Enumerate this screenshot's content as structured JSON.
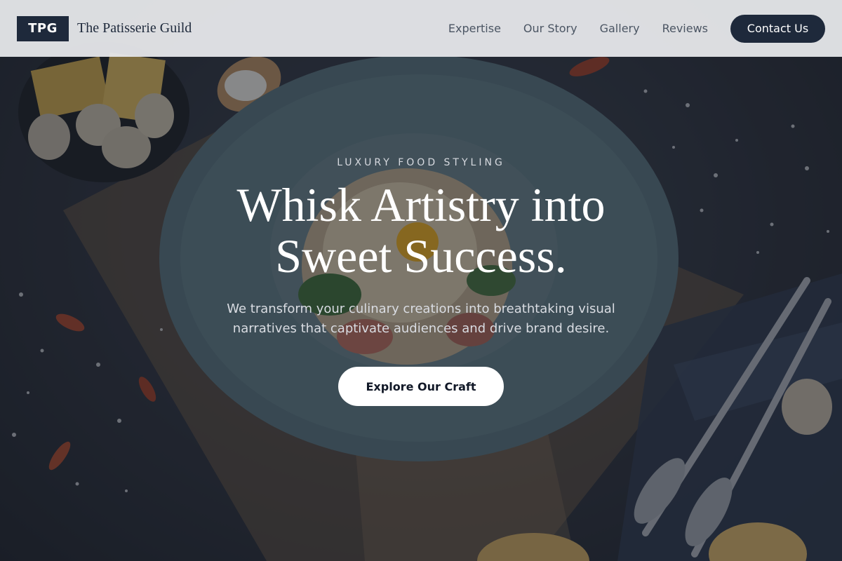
{
  "brand": {
    "logo_text": "TPG",
    "name": "The Patisserie Guild"
  },
  "nav": {
    "items": [
      {
        "label": "Expertise"
      },
      {
        "label": "Our Story"
      },
      {
        "label": "Gallery"
      },
      {
        "label": "Reviews"
      }
    ],
    "contact_label": "Contact Us"
  },
  "hero": {
    "eyebrow": "LUXURY FOOD STYLING",
    "headline": "Whisk Artistry into Sweet Success.",
    "subtext": "We transform your culinary creations into breathtaking visual narratives that captivate audiences and drive brand desire.",
    "cta_label": "Explore Our Craft",
    "background_icon": "plated-pasta-photo"
  },
  "colors": {
    "primary": "#1e293b",
    "header_bg": "#e8e9ec",
    "cta_bg": "#ffffff",
    "text_light": "#ffffff"
  }
}
